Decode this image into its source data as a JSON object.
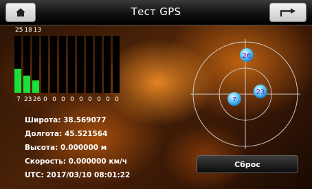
{
  "header": {
    "title": "Тест GPS",
    "home_icon": "home-icon",
    "back_icon": "return-arrow-icon"
  },
  "satellites": {
    "top_labels": "25 18 13",
    "levels": [
      0.42,
      0.3,
      0.22,
      0,
      0,
      0,
      0,
      0,
      0,
      0,
      0,
      0
    ],
    "bar_color": "#19e03a",
    "bottom_labels": [
      "7",
      "23",
      "26",
      "0",
      "0",
      "0",
      "0",
      "0",
      "0",
      "0",
      "0",
      "0"
    ]
  },
  "info": {
    "lat_label": "Широта:",
    "lat_value": "38.569077",
    "lon_label": "Долгота:",
    "lon_value": "45.521564",
    "alt_label": "Высота:",
    "alt_value": "0.000000 м",
    "speed_label": "Скорость:",
    "speed_value": "0.000000 км/ч",
    "utc_label": "UTC:",
    "utc_value": "2017/03/10 08:01:22"
  },
  "radar": {
    "sats": [
      "26",
      "7",
      "23"
    ]
  },
  "reset_button": {
    "label": "Сброс"
  }
}
